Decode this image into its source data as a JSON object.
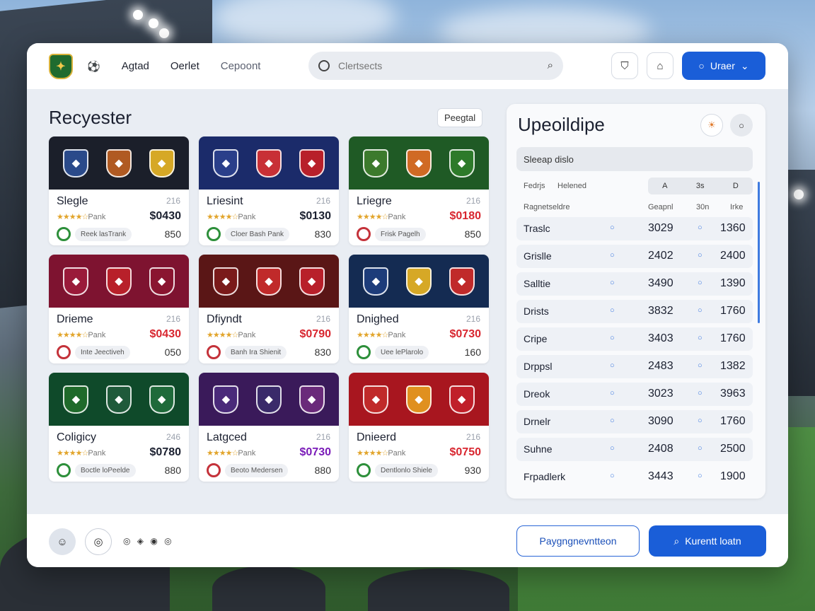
{
  "header": {
    "nav_icon": "soccer-ball-icon",
    "nav": [
      "Agtad",
      "Oerlet",
      "Cepoont"
    ],
    "search_placeholder": "Clertsects",
    "search_icon": "search-icon",
    "icon_buttons": [
      "shield-icon",
      "bell-icon"
    ],
    "primary_label": "Uraer"
  },
  "main": {
    "title": "Recyester",
    "chip": "Peegtal",
    "cards": [
      {
        "name": "Slegle",
        "num": "216",
        "stars": "★★★★☆",
        "rating": "Pank",
        "price": "$0430",
        "price_color": "#1b2030",
        "tag": "Reek lasTrank",
        "small": "850",
        "band": "#1b1f2a",
        "crests": [
          "#2a4a8a",
          "#b05a22",
          "#d6a826"
        ],
        "dot": "green"
      },
      {
        "name": "Lriesint",
        "num": "216",
        "stars": "★★★★☆",
        "rating": "Pank",
        "price": "$0130",
        "price_color": "#1b2030",
        "tag": "Cloer Bash Pank",
        "small": "830",
        "band": "#1b2b6a",
        "crests": [
          "#2a3f8a",
          "#c83036",
          "#b8202a"
        ],
        "dot": "green"
      },
      {
        "name": "Lriegre",
        "num": "216",
        "stars": "★★★★☆",
        "rating": "Pank",
        "price": "$0180",
        "price_color": "#d8262f",
        "tag": "Frisk Pagelh",
        "small": "850",
        "band": "#1f5a25",
        "crests": [
          "#3c7a2c",
          "#d06a24",
          "#2d7a2a"
        ],
        "dot": "red"
      },
      {
        "name": "Drieme",
        "num": "216",
        "stars": "★★★★☆",
        "rating": "Pank",
        "price": "$0430",
        "price_color": "#d8262f",
        "tag": "Inte Jeectiveh",
        "small": "050",
        "band": "#7e1330",
        "crests": [
          "#9a1a3a",
          "#b8202a",
          "#8a1530"
        ],
        "dot": "red"
      },
      {
        "name": "Dfiyndt",
        "num": "216",
        "stars": "★★★★☆",
        "rating": "Pank",
        "price": "$0790",
        "price_color": "#d8262f",
        "tag": "Banh Ira Shienit",
        "small": "830",
        "band": "#5a1616",
        "crests": [
          "#7a1a1a",
          "#c02a2a",
          "#b8202a"
        ],
        "dot": "red"
      },
      {
        "name": "Dnighed",
        "num": "216",
        "stars": "★★★★☆",
        "rating": "Pank",
        "price": "$0730",
        "price_color": "#d8262f",
        "tag": "Uee lePlarolo",
        "small": "160",
        "band": "#142b52",
        "crests": [
          "#1d3c7a",
          "#d6a826",
          "#c02a2a"
        ],
        "dot": "green"
      },
      {
        "name": "Coligicy",
        "num": "246",
        "stars": "★★★★☆",
        "rating": "Pank",
        "price": "$0780",
        "price_color": "#1b2030",
        "tag": "Boctle loPeelde",
        "small": "880",
        "band": "#0f4a2a",
        "crests": [
          "#1f6a2a",
          "#1f5a3a",
          "#1f6a3a"
        ],
        "dot": "green"
      },
      {
        "name": "Latgced",
        "num": "216",
        "stars": "★★★★☆",
        "rating": "Pank",
        "price": "$0730",
        "price_color": "#7a1bb8",
        "tag": "Beoto Medersen",
        "small": "880",
        "band": "#3a1a5a",
        "crests": [
          "#4a2a7a",
          "#3a2a6a",
          "#6a2a7a"
        ],
        "dot": "red"
      },
      {
        "name": "Dnieerd",
        "num": "216",
        "stars": "★★★★☆",
        "rating": "Pank",
        "price": "$0750",
        "price_color": "#d8262f",
        "tag": "Dentlonlo Shiele",
        "small": "930",
        "band": "#a8161f",
        "crests": [
          "#c02a2a",
          "#e0901f",
          "#c0202a"
        ],
        "dot": "green"
      }
    ]
  },
  "panel": {
    "title": "Upeoildipe",
    "btn1_icon": "sun-icon",
    "btn2_icon": "chat-icon",
    "filter": "Sleeap dislo",
    "head_a": "Fedrjs",
    "head_b": "Helened",
    "seg": [
      "A",
      "3s",
      "D"
    ],
    "head_c": "Ragnetseldre",
    "col1": "Geapnl",
    "col2": "30n",
    "col3": "Irke",
    "rows": [
      {
        "name": "Traslc",
        "v1": "3029",
        "v2": "1360"
      },
      {
        "name": "Grislle",
        "v1": "2402",
        "v2": "2400"
      },
      {
        "name": "Salltie",
        "v1": "3490",
        "v2": "1390"
      },
      {
        "name": "Drists",
        "v1": "3832",
        "v2": "1760"
      },
      {
        "name": "Cripe",
        "v1": "3403",
        "v2": "1760"
      },
      {
        "name": "Drppsl",
        "v1": "2483",
        "v2": "1382"
      },
      {
        "name": "Dreok",
        "v1": "3023",
        "v2": "3963"
      },
      {
        "name": "Drnelr",
        "v1": "3090",
        "v2": "1760"
      },
      {
        "name": "Suhne",
        "v1": "2408",
        "v2": "2500"
      },
      {
        "name": "Frpadlerk",
        "v1": "3443",
        "v2": "1900"
      }
    ]
  },
  "footer": {
    "pager": "◎ ◈ ◉ ◎",
    "outline_label": "Paygngnevntteon",
    "solid_label": "Kurentt loatn"
  }
}
